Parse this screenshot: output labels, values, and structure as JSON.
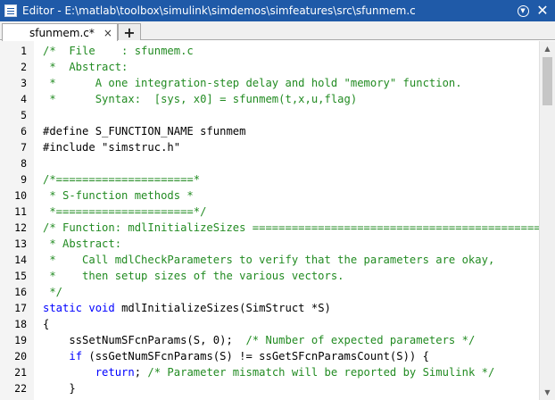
{
  "window": {
    "title": "Editor - E:\\matlab\\toolbox\\simulink\\simdemos\\simfeatures\\src\\sfunmem.c",
    "menu_icon": "circle-chevron-down-icon",
    "close_glyph": "✕"
  },
  "tabs": [
    {
      "label": "sfunmem.c*",
      "close_glyph": "×"
    }
  ],
  "add_tab_glyph": "+",
  "colors": {
    "title_bar": "#1f5aa8",
    "comment": "#228b22",
    "keyword": "#0000ff",
    "string": "#a020f0"
  },
  "lines": [
    {
      "n": "1",
      "segs": [
        {
          "t": "/*  File    : sfunmem.c",
          "c": "com"
        }
      ]
    },
    {
      "n": "2",
      "segs": [
        {
          "t": " *  Abstract:",
          "c": "com"
        }
      ]
    },
    {
      "n": "3",
      "segs": [
        {
          "t": " *      A one integration-step delay and hold \"memory\" function.",
          "c": "com"
        }
      ]
    },
    {
      "n": "4",
      "segs": [
        {
          "t": " *      Syntax:  [sys, x0] = sfunmem(t,x,u,flag)",
          "c": "com"
        }
      ]
    },
    {
      "n": "5",
      "segs": [
        {
          "t": "",
          "c": "txt"
        }
      ]
    },
    {
      "n": "6",
      "segs": [
        {
          "t": "#define S_FUNCTION_NAME sfunmem",
          "c": "pp"
        }
      ]
    },
    {
      "n": "7",
      "segs": [
        {
          "t": "#include ",
          "c": "pp"
        },
        {
          "t": "\"simstruc.h\"",
          "c": "pp"
        }
      ]
    },
    {
      "n": "8",
      "segs": [
        {
          "t": "",
          "c": "txt"
        }
      ]
    },
    {
      "n": "9",
      "segs": [
        {
          "t": "/*=====================*",
          "c": "com"
        }
      ]
    },
    {
      "n": "10",
      "segs": [
        {
          "t": " * S-function methods *",
          "c": "com"
        }
      ]
    },
    {
      "n": "11",
      "segs": [
        {
          "t": " *=====================*/",
          "c": "com"
        }
      ]
    },
    {
      "n": "12",
      "segs": [
        {
          "t": "/* Function: mdlInitializeSizes ===============================================",
          "c": "com"
        }
      ]
    },
    {
      "n": "13",
      "segs": [
        {
          "t": " * Abstract:",
          "c": "com"
        }
      ]
    },
    {
      "n": "14",
      "segs": [
        {
          "t": " *    Call mdlCheckParameters to verify that the parameters are okay,",
          "c": "com"
        }
      ]
    },
    {
      "n": "15",
      "segs": [
        {
          "t": " *    then setup sizes of the various vectors.",
          "c": "com"
        }
      ]
    },
    {
      "n": "16",
      "segs": [
        {
          "t": " */",
          "c": "com"
        }
      ]
    },
    {
      "n": "17",
      "segs": [
        {
          "t": "static",
          "c": "kw"
        },
        {
          "t": " ",
          "c": "txt"
        },
        {
          "t": "void",
          "c": "kw"
        },
        {
          "t": " mdlInitializeSizes(SimStruct *S)",
          "c": "txt"
        }
      ]
    },
    {
      "n": "18",
      "segs": [
        {
          "t": "{",
          "c": "txt"
        }
      ]
    },
    {
      "n": "19",
      "segs": [
        {
          "t": "    ssSetNumSFcnParams(S, 0);  ",
          "c": "txt"
        },
        {
          "t": "/* Number of expected parameters */",
          "c": "com"
        }
      ]
    },
    {
      "n": "20",
      "segs": [
        {
          "t": "    ",
          "c": "txt"
        },
        {
          "t": "if",
          "c": "kw"
        },
        {
          "t": " (ssGetNumSFcnParams(S) != ssGetSFcnParamsCount(S)) {",
          "c": "txt"
        }
      ]
    },
    {
      "n": "21",
      "segs": [
        {
          "t": "        ",
          "c": "txt"
        },
        {
          "t": "return",
          "c": "kw"
        },
        {
          "t": "; ",
          "c": "txt"
        },
        {
          "t": "/* Parameter mismatch will be reported by Simulink */",
          "c": "com"
        }
      ]
    },
    {
      "n": "22",
      "segs": [
        {
          "t": "    }",
          "c": "txt"
        }
      ]
    }
  ],
  "scrollbar": {
    "up_glyph": "▲",
    "down_glyph": "▼"
  }
}
